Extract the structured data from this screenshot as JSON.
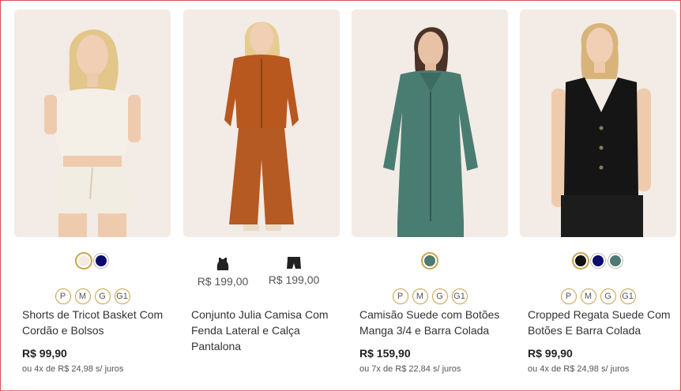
{
  "products": [
    {
      "name": "Shorts de Tricot Basket Com Cordão e Bolsos",
      "price": "R$ 99,90",
      "installments": "ou 4x de R$ 24,98 s/ juros",
      "swatches": [
        "#f2ebe0",
        "#0b0b6e"
      ],
      "sizes": [
        "P",
        "M",
        "G",
        "G1"
      ]
    },
    {
      "name": "Conjunto Julia Camisa Com Fenda Lateral e Calça Pantalona",
      "kit_items": [
        {
          "icon": "tank-top-icon",
          "price": "R$ 199,00"
        },
        {
          "icon": "shorts-icon",
          "price": "R$ 199,00"
        }
      ]
    },
    {
      "name": "Camisão Suede com Botões Manga 3/4 e Barra Colada",
      "price": "R$ 159,90",
      "installments": "ou 7x de R$ 22,84 s/ juros",
      "swatches": [
        "#4d7a72"
      ],
      "sizes": [
        "P",
        "M",
        "G",
        "G1"
      ]
    },
    {
      "name": "Cropped Regata Suede Com Botões E Barra Colada",
      "price": "R$ 99,90",
      "installments": "ou 4x de R$ 24,98 s/ juros",
      "swatches": [
        "#111111",
        "#0b0b6e",
        "#4d7a72"
      ],
      "sizes": [
        "P",
        "M",
        "G",
        "G1"
      ]
    }
  ]
}
